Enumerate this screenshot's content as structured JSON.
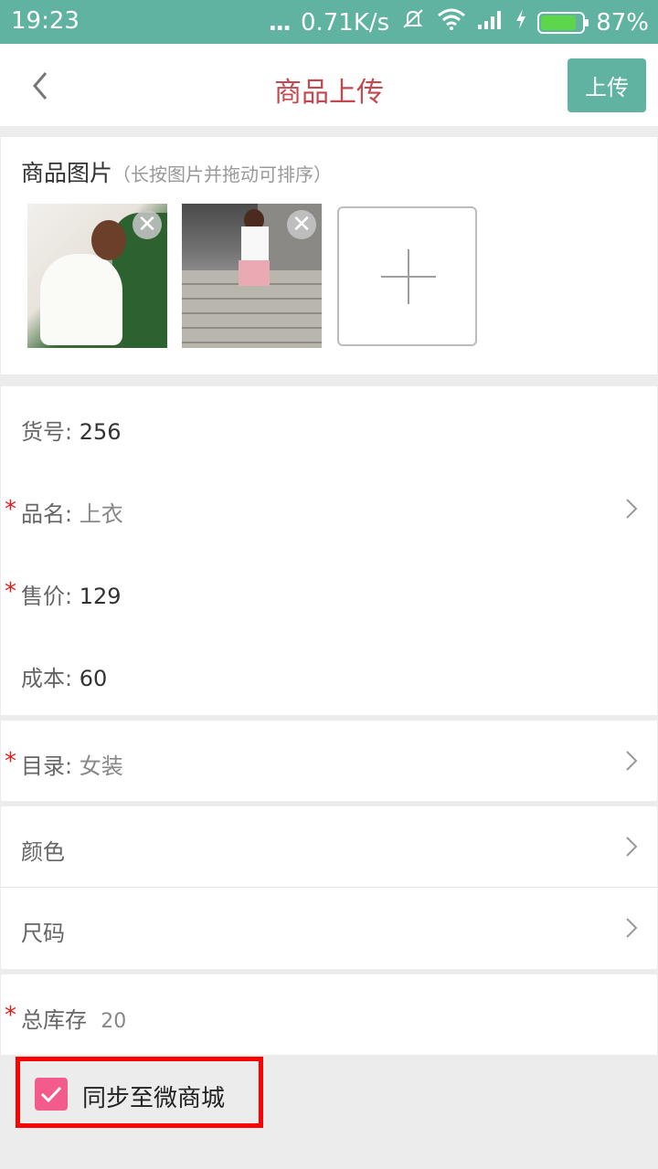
{
  "status_bar": {
    "time": "19:23",
    "dots": "...",
    "net_speed": "0.71K/s",
    "battery_percent": "87%",
    "battery_level": 0.87,
    "icons": [
      "muted-ring-icon",
      "wifi-icon",
      "signal-icon",
      "charging-icon",
      "battery-icon"
    ]
  },
  "header": {
    "title": "商品上传",
    "upload_label": "上传",
    "back_icon": "chevron-left-icon"
  },
  "photos": {
    "label": "商品图片",
    "hint": "（长按图片并拖动可排序）",
    "remove_glyph": "✕"
  },
  "fields": [
    {
      "key": "item_no",
      "label": "货号:",
      "value": "256",
      "required": false
    },
    {
      "key": "name",
      "label": "品名:",
      "value": "上衣",
      "required": true
    },
    {
      "key": "price",
      "label": "售价:",
      "value": "129",
      "required": true
    },
    {
      "key": "cost",
      "label": "成本:",
      "value": "60",
      "required": false
    }
  ],
  "required_mark": "*",
  "catalog": {
    "label": "目录:",
    "value": "女装"
  },
  "color": {
    "label": "颜色"
  },
  "size": {
    "label": "尺码"
  },
  "stock": {
    "label": "总库存",
    "value": "20"
  },
  "sync": {
    "label": "同步至微商城",
    "checked": true
  },
  "colors": {
    "accent": "#5fb3a0",
    "title": "#c1494f",
    "required": "#e02020",
    "checkbox": "#f25b8c",
    "highlight": "#ff0000"
  }
}
